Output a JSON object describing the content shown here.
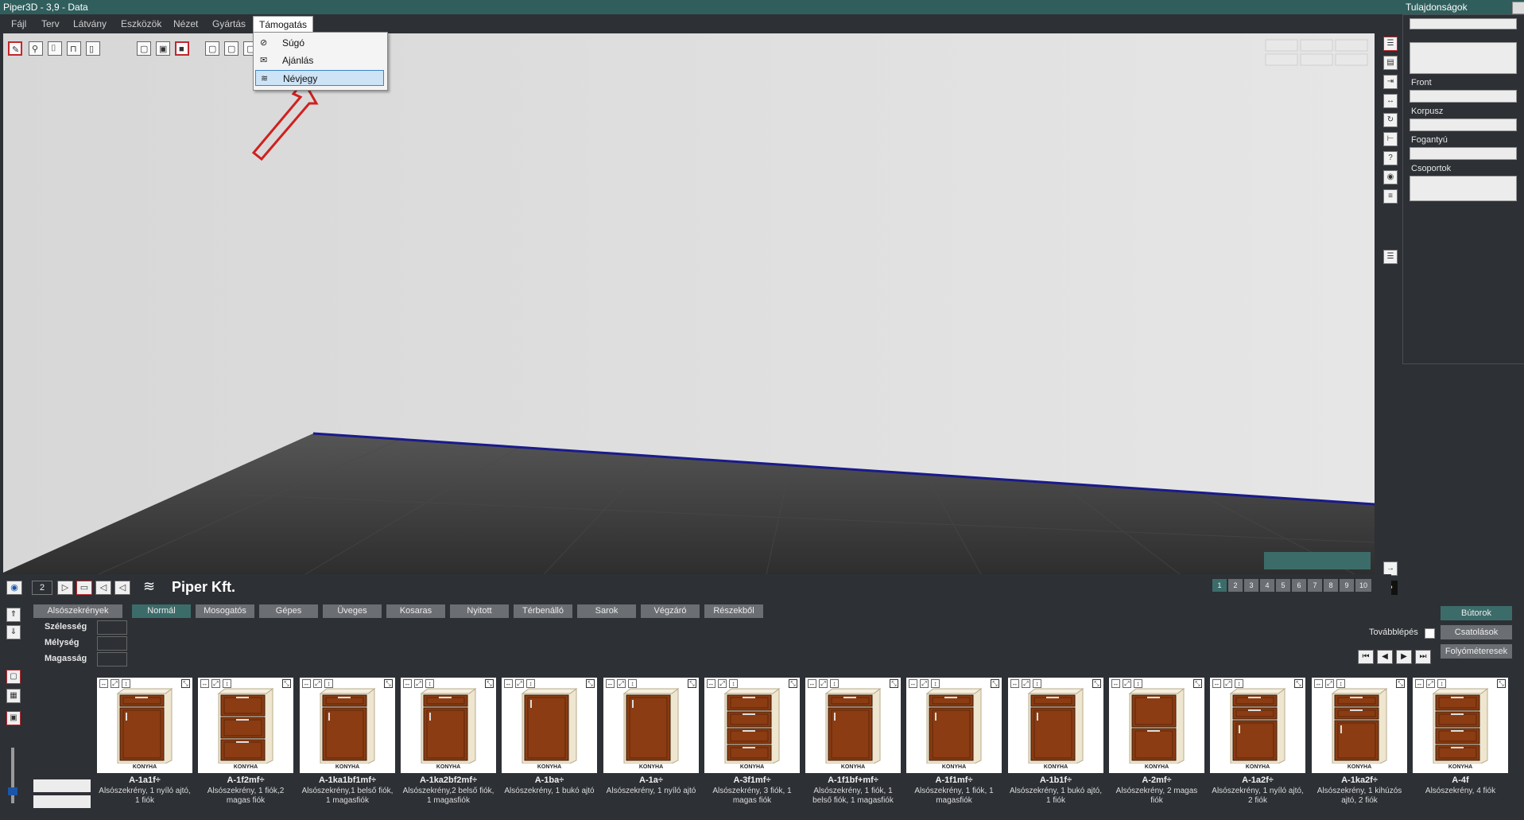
{
  "window": {
    "title": "Piper3D - 3,9 - Data",
    "properties_title": "Tulajdonságok"
  },
  "menu": {
    "items": [
      "Fájl",
      "Terv",
      "Látvány",
      "Eszközök",
      "Nézet",
      "Gyártás",
      "Támogatás"
    ],
    "open_menu": "Támogatás",
    "dropdown": [
      {
        "label": "Súgó",
        "icon": "help-circle-icon"
      },
      {
        "label": "Ajánlás",
        "icon": "envelope-icon"
      },
      {
        "label": "Névjegy",
        "icon": "logo-icon",
        "selected": true
      }
    ]
  },
  "properties": {
    "front_label": "Front",
    "korpusz_label": "Korpusz",
    "fogantyu_label": "Fogantyú",
    "csoportok_label": "Csoportok"
  },
  "bottombar": {
    "view_number": "2",
    "company": "Piper Kft.",
    "pages": [
      "1",
      "2",
      "3",
      "4",
      "5",
      "6",
      "7",
      "8",
      "9",
      "10"
    ],
    "active_page": "1"
  },
  "catalog": {
    "section_label": "Alsószekrények",
    "categories": [
      "Normál",
      "Mosogatós",
      "Gépes",
      "Üveges",
      "Kosaras",
      "Nyitott",
      "Térbenálló",
      "Sarok",
      "Végzáró",
      "Részekből"
    ],
    "active_category": "Normál",
    "dims": {
      "width_label": "Szélesség",
      "depth_label": "Mélység",
      "height_label": "Magasság"
    },
    "continue_label": "Továbblépés",
    "right_buttons": [
      "Bútorok",
      "Csatolások",
      "Folyóméteresek"
    ],
    "brand_label": "KONYHA",
    "items": [
      {
        "name": "A-1a1f÷",
        "desc": "Alsószekrény, 1 nyíló ajtó, 1 fiók"
      },
      {
        "name": "A-1f2mf÷",
        "desc": "Alsószekrény, 1 fiók,2 magas fiók"
      },
      {
        "name": "A-1ka1bf1mf÷",
        "desc": "Alsószekrény,1 belső fiók, 1 magasfiók"
      },
      {
        "name": "A-1ka2bf2mf÷",
        "desc": "Alsószekrény,2 belső fiók, 1 magasfiók"
      },
      {
        "name": "A-1ba÷",
        "desc": "Alsószekrény, 1 bukó ajtó"
      },
      {
        "name": "A-1a÷",
        "desc": "Alsószekrény, 1 nyíló ajtó"
      },
      {
        "name": "A-3f1mf÷",
        "desc": "Alsószekrény, 3 fiók, 1 magas fiók"
      },
      {
        "name": "A-1f1bf+mf÷",
        "desc": "Alsószekrény, 1 fiók, 1 belső fiók, 1 magasfiók"
      },
      {
        "name": "A-1f1mf÷",
        "desc": "Alsószekrény, 1 fiók, 1 magasfiók"
      },
      {
        "name": "A-1b1f÷",
        "desc": "Alsószekrény, 1 bukó ajtó, 1 fiók"
      },
      {
        "name": "A-2mf÷",
        "desc": "Alsószekrény, 2 magas fiók"
      },
      {
        "name": "A-1a2f÷",
        "desc": "Alsószekrény, 1 nyíló ajtó, 2 fiók"
      },
      {
        "name": "A-1ka2f÷",
        "desc": "Alsószekrény, 1 kihúzós ajtó, 2 fiók"
      },
      {
        "name": "A-4f",
        "desc": "Alsószekrény, 4 fiók"
      }
    ]
  },
  "colors": {
    "titlebar": "#2f5e5c",
    "panel_bg": "#2d3035",
    "accent_teal": "#3c6c6a",
    "wood": "#8b3c12",
    "floor_line": "#1a1a8c",
    "arrow": "#d02020"
  }
}
